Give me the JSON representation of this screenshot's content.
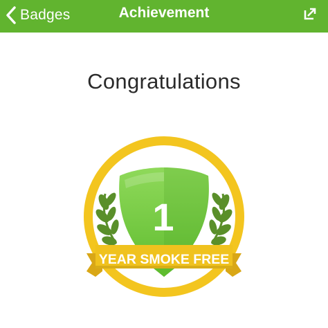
{
  "nav": {
    "back_label": "Badges",
    "title": "Achievement",
    "share_icon": "share-out-icon"
  },
  "headline": "Congratulations",
  "badge": {
    "number": "1",
    "ribbon_text": "YEAR SMOKE FREE",
    "icons": [
      "laurel-left-icon",
      "laurel-right-icon",
      "shield-icon"
    ]
  },
  "colors": {
    "nav_bg": "#61b42f",
    "ring_gold": "#f3c51f",
    "ribbon_gold": "#f0c21e",
    "shield_green": "#7dd050"
  }
}
